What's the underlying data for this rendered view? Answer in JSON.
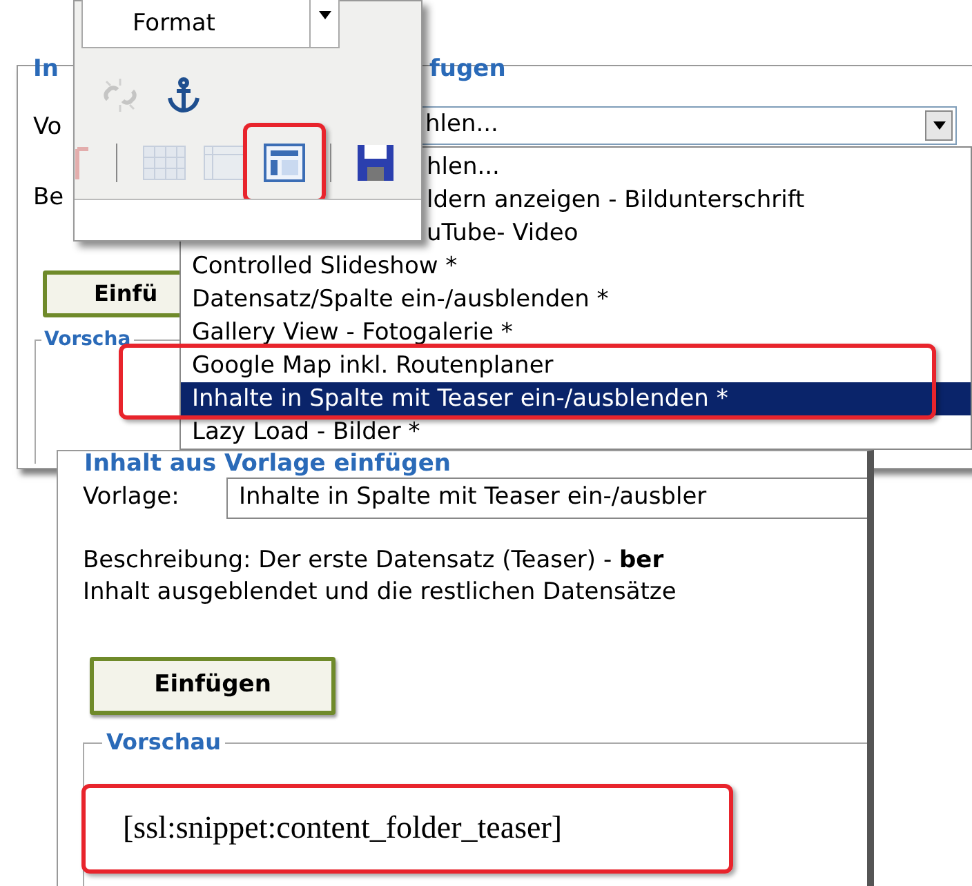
{
  "back_dialog": {
    "title_fragments": [
      "In",
      "fugen"
    ],
    "template_label": "Vo",
    "template_select": {
      "value": "hlen..."
    },
    "description_label": "Be",
    "insert_button": "Einfü",
    "preview_legend": "Vorscha"
  },
  "format_toolbar": {
    "format_select": {
      "value": "Format"
    },
    "rows": [
      [
        {
          "kind": "unlink",
          "disabled": true,
          "highlighted": false
        },
        {
          "kind": "anchor",
          "disabled": false,
          "highlighted": false
        }
      ],
      [
        {
          "kind": "partial",
          "disabled": true,
          "highlighted": false
        },
        {
          "kind": "separator"
        },
        {
          "kind": "table",
          "disabled": true,
          "highlighted": false
        },
        {
          "kind": "table-panel",
          "disabled": true,
          "highlighted": false
        },
        {
          "kind": "template",
          "disabled": false,
          "highlighted": true
        },
        {
          "kind": "separator"
        },
        {
          "kind": "save",
          "disabled": false,
          "highlighted": false
        }
      ]
    ]
  },
  "template_dropdown": {
    "options": [
      {
        "label": "hlen...",
        "selected": false,
        "highlighted": false
      },
      {
        "label": "ldern anzeigen - Bildunterschrift",
        "selected": false,
        "highlighted": false
      },
      {
        "label": "uTube- Video",
        "selected": false,
        "highlighted": false
      },
      {
        "label": "Controlled Slideshow *",
        "selected": false,
        "highlighted": false
      },
      {
        "label": "Datensatz/Spalte ein-/ausblenden *",
        "selected": false,
        "highlighted": false
      },
      {
        "label": "Gallery View - Fotogalerie *",
        "selected": false,
        "highlighted": false
      },
      {
        "label": "Google Map inkl. Routenplaner",
        "selected": false,
        "highlighted": true
      },
      {
        "label": "Inhalte in Spalte mit Teaser ein-/ausblenden *",
        "selected": true,
        "highlighted": true
      },
      {
        "label": "Lazy Load - Bilder *",
        "selected": false,
        "highlighted": false
      }
    ]
  },
  "front_dialog": {
    "title": "Inhalt aus Vorlage einfügen",
    "template_label": "Vorlage:",
    "template_select": {
      "value": "Inhalte in Spalte mit Teaser ein-/ausbler"
    },
    "description": [
      "Beschreibung: Der erste Datensatz (Teaser) - **ber**",
      "Inhalt ausgeblendet und die restlichen Datensätze"
    ],
    "insert_button": "Einfügen",
    "preview_legend": "Vorschau",
    "preview": {
      "snippet": "[ssl:snippet:content_folder_teaser]",
      "highlighted": true
    }
  }
}
